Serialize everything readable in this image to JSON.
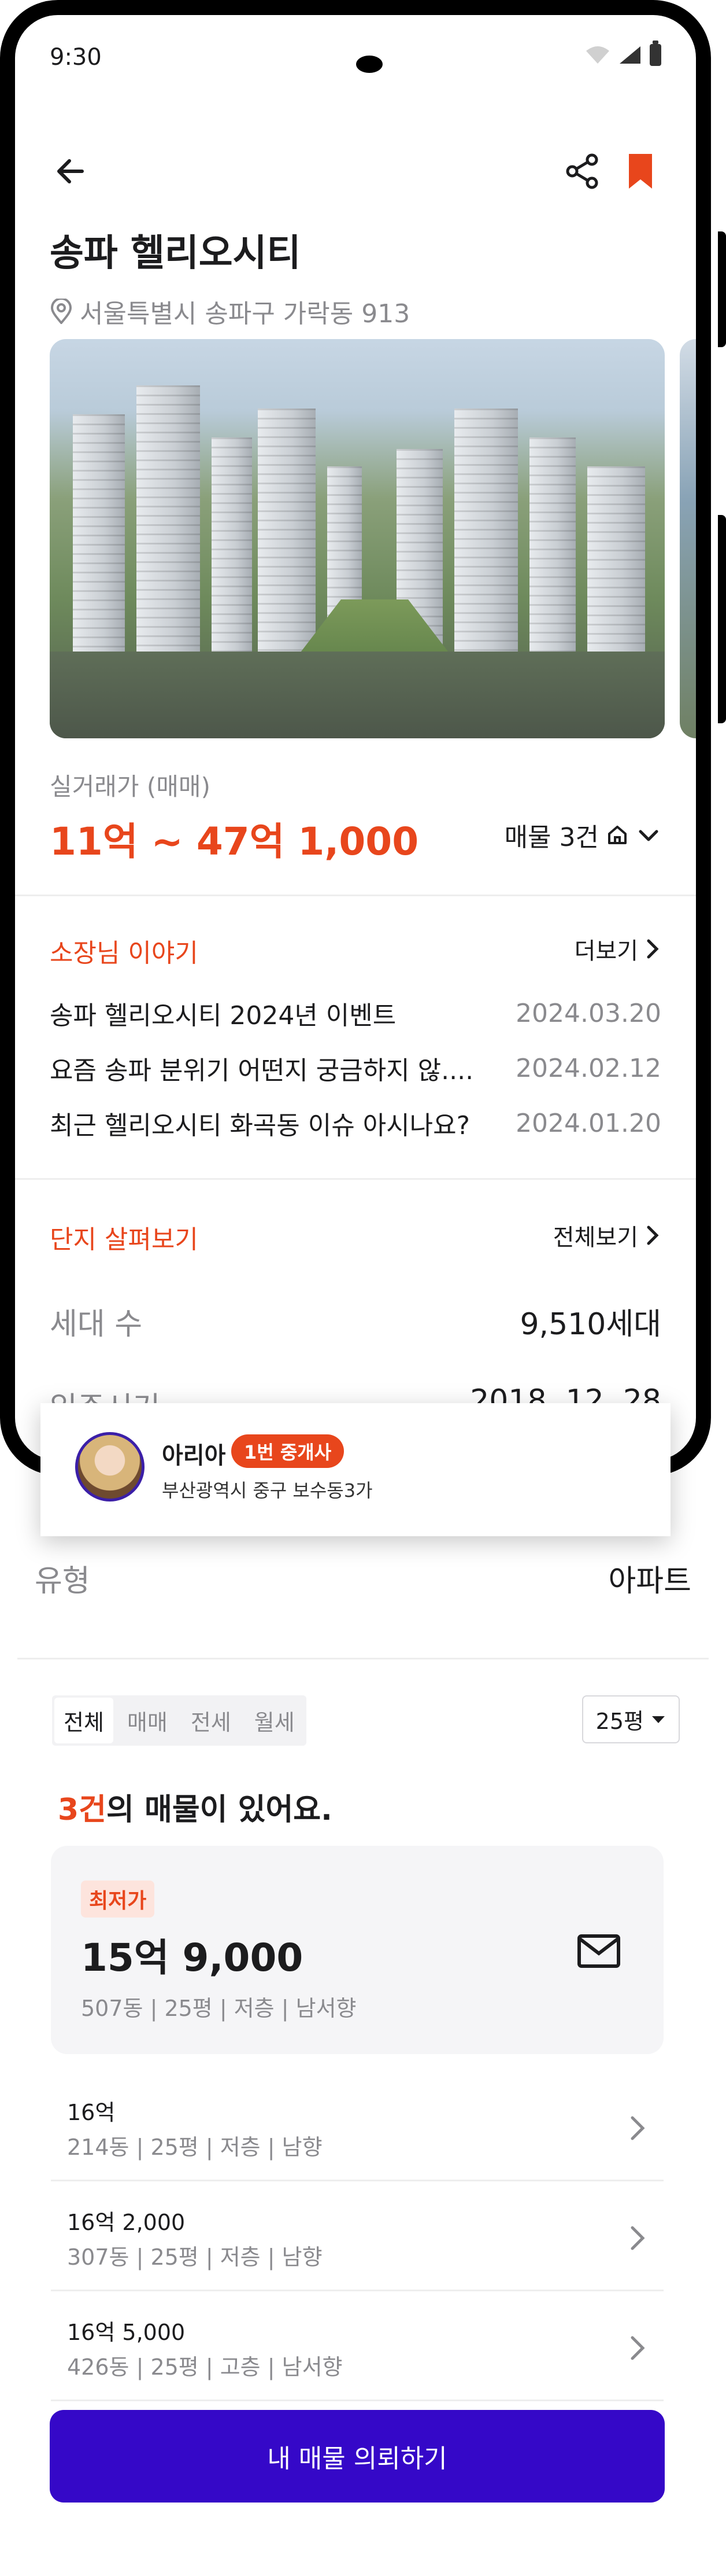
{
  "status_bar": {
    "time": "9:30"
  },
  "complex": {
    "name": "송파 헬리오시티",
    "address": "서울특별시 송파구 가락동 913"
  },
  "price": {
    "label": "실거래가 (매매)",
    "range": "11억 ~ 47억 1,000",
    "listings_toggle": "매물 3건"
  },
  "stories": {
    "title": "소장님 이야기",
    "more": "더보기",
    "items": [
      {
        "title": "송파 헬리오시티 2024년 이벤트",
        "date": "2024.03.20"
      },
      {
        "title": "요즘 송파 분위기 어떤지 궁금하지 않....",
        "date": "2024.02.12"
      },
      {
        "title": "최근 헬리오시티 화곡동 이슈 아시나요?",
        "date": "2024.01.20"
      }
    ]
  },
  "overview": {
    "title": "단지 살펴보기",
    "more": "전체보기",
    "rows": [
      {
        "label": "세대 수",
        "value": "9,510세대"
      },
      {
        "label": "입주시기",
        "value": "2018. 12. 28"
      },
      {
        "label": "유형",
        "value": "아파트"
      }
    ]
  },
  "agent": {
    "name": "아리아",
    "badge": "1번 중개사",
    "address": "부산광역시 중구 보수동3가"
  },
  "filter": {
    "tabs": [
      "전체",
      "매매",
      "전세",
      "월세"
    ],
    "size": "25평"
  },
  "summary": {
    "count": "3건",
    "suffix": "의 매물이 있어요."
  },
  "best_listing": {
    "badge": "최저가",
    "price": "15억 9,000",
    "info": "507동 | 25평 | 저층 | 남서향"
  },
  "listings": [
    {
      "price": "16억",
      "info": "214동 | 25평 | 저층 | 남향"
    },
    {
      "price": "16억 2,000",
      "info": "307동 | 25평 | 저층 | 남향"
    },
    {
      "price": "16억 5,000",
      "info": "426동 | 25평 | 고층 | 남서향"
    }
  ],
  "cta": {
    "label": "내 매물 의뢰하기"
  },
  "colors": {
    "accent": "#e8461c",
    "primary": "#3508c8",
    "muted": "#8a8a8e"
  }
}
